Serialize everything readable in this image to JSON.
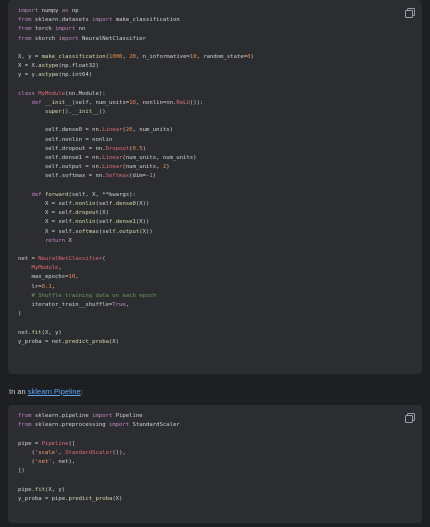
{
  "block1": {
    "copy_icon": "copy-icon",
    "lines": [
      [
        [
          "kw",
          "import"
        ],
        [
          "id",
          " numpy "
        ],
        [
          "kw",
          "as"
        ],
        [
          "id",
          " np"
        ]
      ],
      [
        [
          "kw",
          "from"
        ],
        [
          "id",
          " sklearn.datasets "
        ],
        [
          "kw",
          "import"
        ],
        [
          "id",
          " make_classification"
        ]
      ],
      [
        [
          "kw",
          "from"
        ],
        [
          "id",
          " torch "
        ],
        [
          "kw",
          "import"
        ],
        [
          "id",
          " nn"
        ]
      ],
      [
        [
          "kw",
          "from"
        ],
        [
          "id",
          " skorch "
        ],
        [
          "kw",
          "import"
        ],
        [
          "id",
          " NeuralNetClassifier"
        ]
      ],
      [],
      [
        [
          "id",
          "X, y = "
        ],
        [
          "fn",
          "make_classification"
        ],
        [
          "id",
          "("
        ],
        [
          "num",
          "1000"
        ],
        [
          "id",
          ", "
        ],
        [
          "num",
          "20"
        ],
        [
          "id",
          ", n_informative="
        ],
        [
          "num",
          "10"
        ],
        [
          "id",
          ", random_state="
        ],
        [
          "num",
          "0"
        ],
        [
          "id",
          ")"
        ]
      ],
      [
        [
          "id",
          "X = X."
        ],
        [
          "fn",
          "astype"
        ],
        [
          "id",
          "(np.float32)"
        ]
      ],
      [
        [
          "id",
          "y = y."
        ],
        [
          "fn",
          "astype"
        ],
        [
          "id",
          "(np.int64)"
        ]
      ],
      [],
      [
        [
          "kw",
          "class"
        ],
        [
          "id",
          " "
        ],
        [
          "cls",
          "MyModule"
        ],
        [
          "id",
          "(nn.Module):"
        ]
      ],
      [
        [
          "id",
          "    "
        ],
        [
          "kw",
          "def"
        ],
        [
          "id",
          " "
        ],
        [
          "fn",
          "__init__"
        ],
        [
          "id",
          "(self, num_units="
        ],
        [
          "num",
          "10"
        ],
        [
          "id",
          ", nonlin=nn."
        ],
        [
          "cls",
          "ReLU"
        ],
        [
          "id",
          "()):"
        ]
      ],
      [
        [
          "id",
          "        "
        ],
        [
          "fn",
          "super"
        ],
        [
          "id",
          "()."
        ],
        [
          "fn",
          "__init__"
        ],
        [
          "id",
          "()"
        ]
      ],
      [],
      [
        [
          "id",
          "        self.dense0 = nn."
        ],
        [
          "cls",
          "Linear"
        ],
        [
          "id",
          "("
        ],
        [
          "num",
          "20"
        ],
        [
          "id",
          ", num_units)"
        ]
      ],
      [
        [
          "id",
          "        self.nonlin = nonlin"
        ]
      ],
      [
        [
          "id",
          "        self.dropout = nn."
        ],
        [
          "cls",
          "Dropout"
        ],
        [
          "id",
          "("
        ],
        [
          "num",
          "0.5"
        ],
        [
          "id",
          ")"
        ]
      ],
      [
        [
          "id",
          "        self.dense1 = nn."
        ],
        [
          "cls",
          "Linear"
        ],
        [
          "id",
          "(num_units, num_units)"
        ]
      ],
      [
        [
          "id",
          "        self.output = nn."
        ],
        [
          "cls",
          "Linear"
        ],
        [
          "id",
          "(num_units, "
        ],
        [
          "num",
          "2"
        ],
        [
          "id",
          ")"
        ]
      ],
      [
        [
          "id",
          "        self.softmax = nn."
        ],
        [
          "cls",
          "Softmax"
        ],
        [
          "id",
          "(dim=-"
        ],
        [
          "num",
          "1"
        ],
        [
          "id",
          ")"
        ]
      ],
      [],
      [
        [
          "id",
          "    "
        ],
        [
          "kw",
          "def"
        ],
        [
          "id",
          " "
        ],
        [
          "fn",
          "forward"
        ],
        [
          "id",
          "(self, X, **kwargs):"
        ]
      ],
      [
        [
          "id",
          "        X = self."
        ],
        [
          "fn",
          "nonlin"
        ],
        [
          "id",
          "(self."
        ],
        [
          "fn",
          "dense0"
        ],
        [
          "id",
          "(X))"
        ]
      ],
      [
        [
          "id",
          "        X = self."
        ],
        [
          "fn",
          "dropout"
        ],
        [
          "id",
          "(X)"
        ]
      ],
      [
        [
          "id",
          "        X = self."
        ],
        [
          "fn",
          "nonlin"
        ],
        [
          "id",
          "(self."
        ],
        [
          "fn",
          "dense1"
        ],
        [
          "id",
          "(X))"
        ]
      ],
      [
        [
          "id",
          "        X = self."
        ],
        [
          "fn",
          "softmax"
        ],
        [
          "id",
          "(self."
        ],
        [
          "fn",
          "output"
        ],
        [
          "id",
          "(X))"
        ]
      ],
      [
        [
          "id",
          "        "
        ],
        [
          "kw",
          "return"
        ],
        [
          "id",
          " X"
        ]
      ],
      [],
      [
        [
          "id",
          "net = "
        ],
        [
          "cls",
          "NeuralNetClassifier"
        ],
        [
          "id",
          "("
        ]
      ],
      [
        [
          "id",
          "    "
        ],
        [
          "cls",
          "MyModule"
        ],
        [
          "id",
          ","
        ]
      ],
      [
        [
          "id",
          "    max_epochs="
        ],
        [
          "num",
          "10"
        ],
        [
          "id",
          ","
        ]
      ],
      [
        [
          "id",
          "    lr="
        ],
        [
          "num",
          "0.1"
        ],
        [
          "id",
          ","
        ]
      ],
      [
        [
          "cm",
          "    # Shuffle training data on each epoch"
        ]
      ],
      [
        [
          "id",
          "    iterator_train__shuffle="
        ],
        [
          "kw",
          "True"
        ],
        [
          "id",
          ","
        ]
      ],
      [
        [
          "id",
          ")"
        ]
      ],
      [],
      [
        [
          "id",
          "net."
        ],
        [
          "fn",
          "fit"
        ],
        [
          "id",
          "(X, y)"
        ]
      ],
      [
        [
          "id",
          "y_proba = net."
        ],
        [
          "fn",
          "predict_proba"
        ],
        [
          "id",
          "(X)"
        ]
      ]
    ]
  },
  "prose": {
    "prefix": "In an ",
    "link": "sklearn Pipeline",
    "suffix": ":"
  },
  "block2": {
    "copy_icon": "copy-icon",
    "lines": [
      [
        [
          "kw",
          "from"
        ],
        [
          "id",
          " sklearn.pipeline "
        ],
        [
          "kw",
          "import"
        ],
        [
          "id",
          " Pipeline"
        ]
      ],
      [
        [
          "kw",
          "from"
        ],
        [
          "id",
          " sklearn.preprocessing "
        ],
        [
          "kw",
          "import"
        ],
        [
          "id",
          " StandardScaler"
        ]
      ],
      [],
      [
        [
          "id",
          "pipe = "
        ],
        [
          "cls",
          "Pipeline"
        ],
        [
          "id",
          "(["
        ]
      ],
      [
        [
          "id",
          "    ("
        ],
        [
          "str",
          "'scale'"
        ],
        [
          "id",
          ", "
        ],
        [
          "cls",
          "StandardScaler"
        ],
        [
          "id",
          "()),"
        ]
      ],
      [
        [
          "id",
          "    ("
        ],
        [
          "str",
          "'net'"
        ],
        [
          "id",
          ", net),"
        ]
      ],
      [
        [
          "id",
          "])"
        ]
      ],
      [],
      [
        [
          "id",
          "pipe."
        ],
        [
          "fn",
          "fit"
        ],
        [
          "id",
          "(X, y)"
        ]
      ],
      [
        [
          "id",
          "y_proba = pipe."
        ],
        [
          "fn",
          "predict_proba"
        ],
        [
          "id",
          "(X)"
        ]
      ]
    ]
  }
}
